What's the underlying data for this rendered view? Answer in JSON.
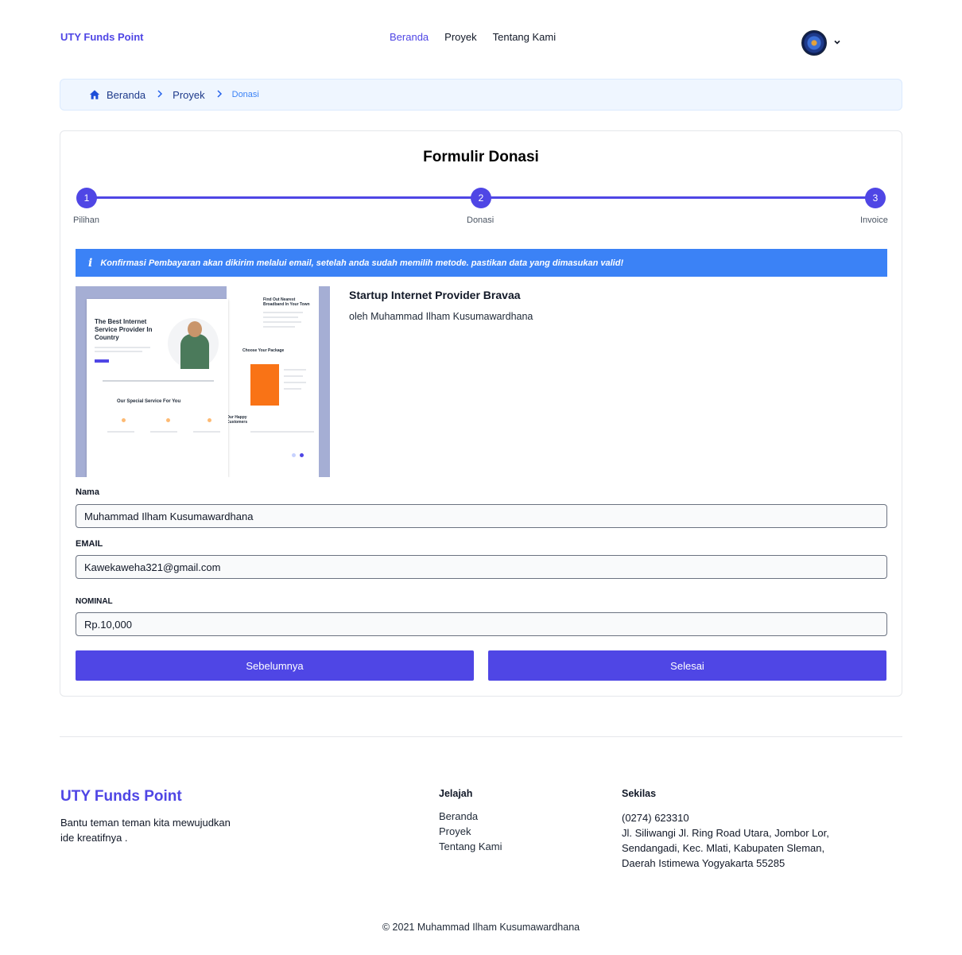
{
  "nav": {
    "brand": "UTY Funds Point",
    "links": [
      "Beranda",
      "Proyek",
      "Tentang Kami"
    ],
    "active_link": "Beranda",
    "avatar_icon": "user-avatar-icon",
    "dropdown_icon": "chevron-down-icon"
  },
  "breadcrumb": {
    "items": [
      "Beranda",
      "Proyek"
    ],
    "current": "Donasi"
  },
  "form_card": {
    "title": "Formulir Donasi",
    "steps": [
      {
        "number": "1",
        "label": "Pilihan"
      },
      {
        "number": "2",
        "label": "Donasi"
      },
      {
        "number": "3",
        "label": "Invoice"
      }
    ],
    "alert": "Konfirmasi Pembayaran akan dikirim melalui email, setelah anda sudah memilih metode. pastikan data yang dimasukan valid!",
    "project": {
      "title": "Startup Internet Provider Bravaa",
      "author": "oleh Muhammad Ilham Kusumawardhana",
      "image_text": {
        "headline": "The Best Internet Service Provider In Country",
        "service": "Our Special Service For You",
        "find": "Find Out Nearest Broadband In Your Town",
        "package": "Choose Your Package",
        "customers": "Our Happy Customers"
      }
    },
    "fields": {
      "name_label": "Nama",
      "name_value": "Muhammad Ilham Kusumawardhana",
      "email_label": "EMAIL",
      "email_value": "Kawekaweha321@gmail.com",
      "nominal_label": "NOMINAL",
      "nominal_value": "Rp.10,000"
    },
    "buttons": {
      "previous": "Sebelumnya",
      "finish": "Selesai"
    }
  },
  "colors": {
    "primary": "#4f46e5",
    "alert": "#3b82f6",
    "breadcrumb_bg": "#eff6ff"
  },
  "footer": {
    "brand": "UTY Funds Point",
    "tagline": "Bantu teman teman kita mewujudkan ide kreatifnya .",
    "explore_title": "Jelajah",
    "explore_links": [
      "Beranda",
      "Proyek",
      "Tentang Kami"
    ],
    "contact_title": "Sekilas",
    "phone": "(0274) 623310",
    "address": "Jl. Siliwangi Jl. Ring Road Utara, Jombor Lor, Sendangadi, Kec. Mlati, Kabupaten Sleman, Daerah Istimewa Yogyakarta 55285",
    "copyright": "© 2021 Muhammad Ilham Kusumawardhana"
  }
}
